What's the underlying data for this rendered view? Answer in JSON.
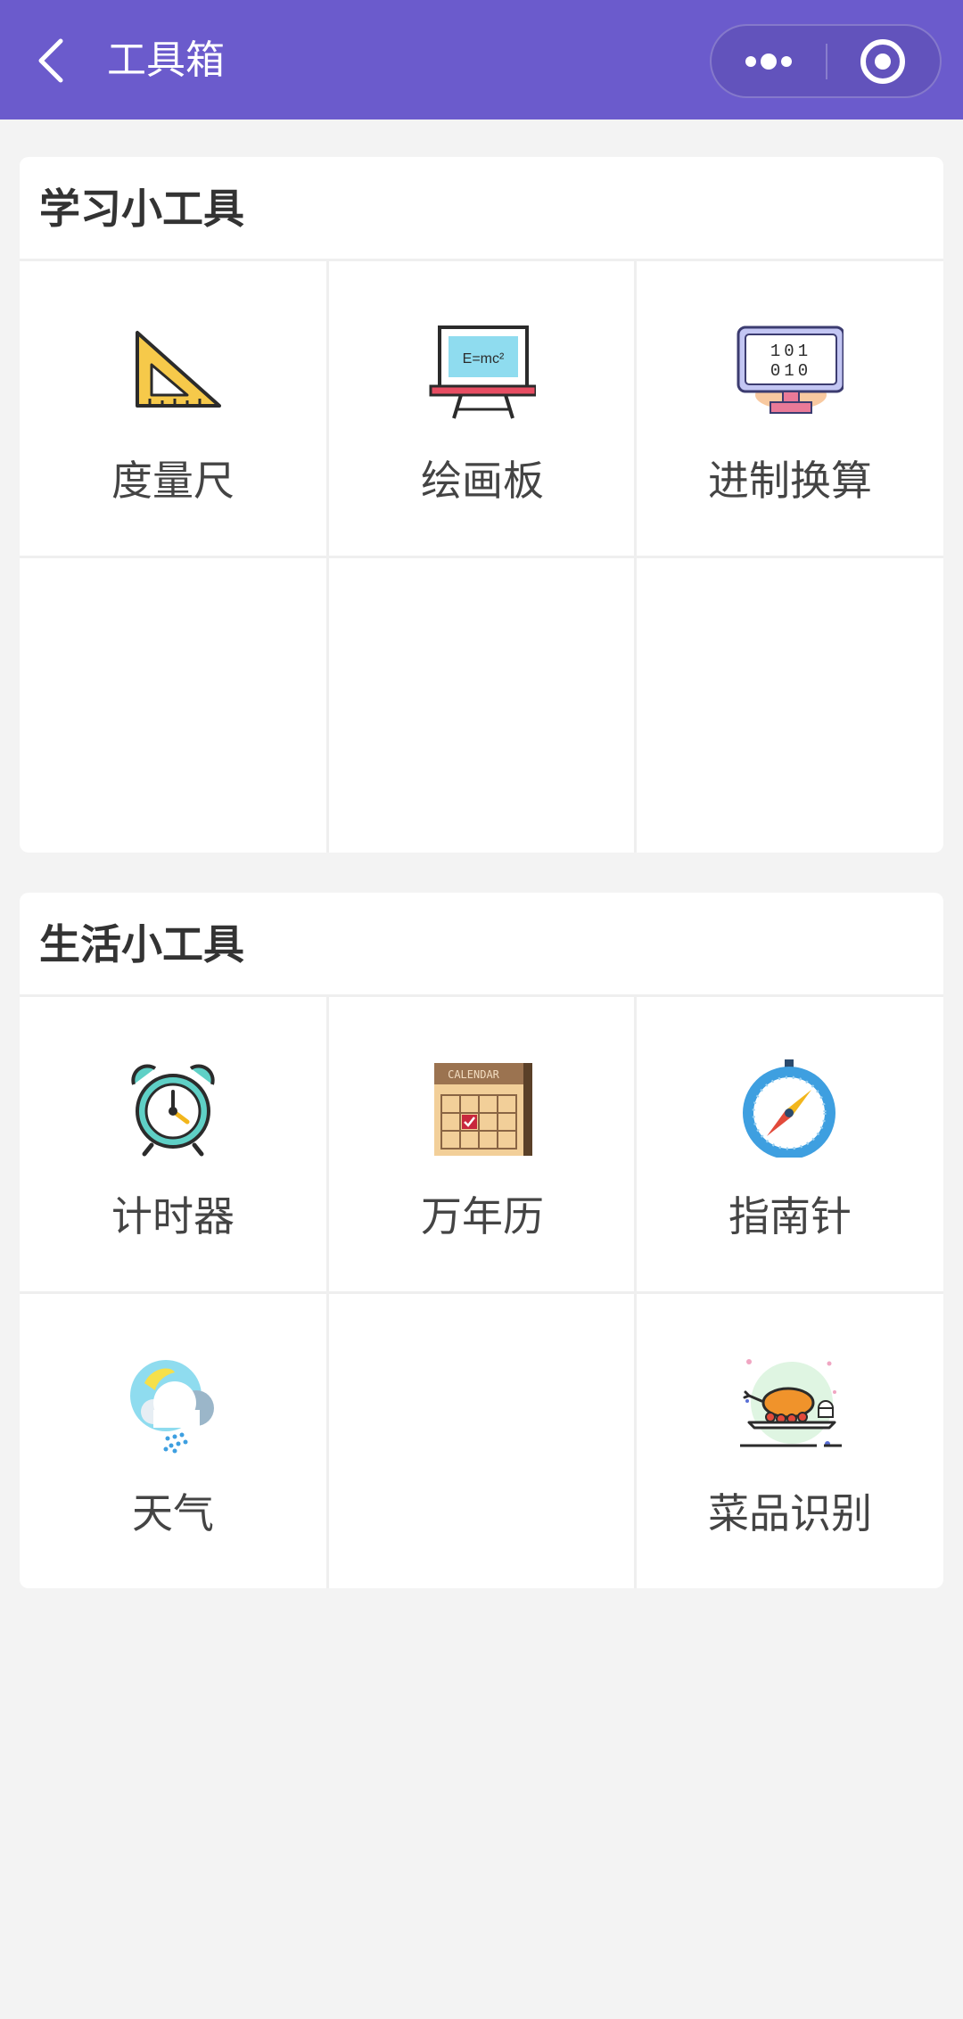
{
  "navbar": {
    "title": "工具箱",
    "background": "#6b5bcc",
    "icons": [
      "back-chevron-icon",
      "more-dots-icon",
      "close-target-icon"
    ]
  },
  "sections": [
    {
      "title": "学习小工具",
      "items": [
        {
          "label": "度量尺",
          "icon": "set-square-ruler-icon"
        },
        {
          "label": "绘画板",
          "icon": "blackboard-easel-icon",
          "icon_text": "E=mc²"
        },
        {
          "label": "进制换算",
          "icon": "binary-monitor-icon",
          "icon_text": [
            "101",
            "010"
          ]
        }
      ]
    },
    {
      "title": "生活小工具",
      "items": [
        {
          "label": "计时器",
          "icon": "alarm-clock-icon"
        },
        {
          "label": "万年历",
          "icon": "calendar-icon",
          "icon_text": "CALENDAR"
        },
        {
          "label": "指南针",
          "icon": "compass-icon"
        },
        {
          "label": "天气",
          "icon": "weather-sun-cloud-icon"
        },
        {
          "label": "菜品识别",
          "icon": "roast-dish-icon"
        }
      ]
    }
  ]
}
